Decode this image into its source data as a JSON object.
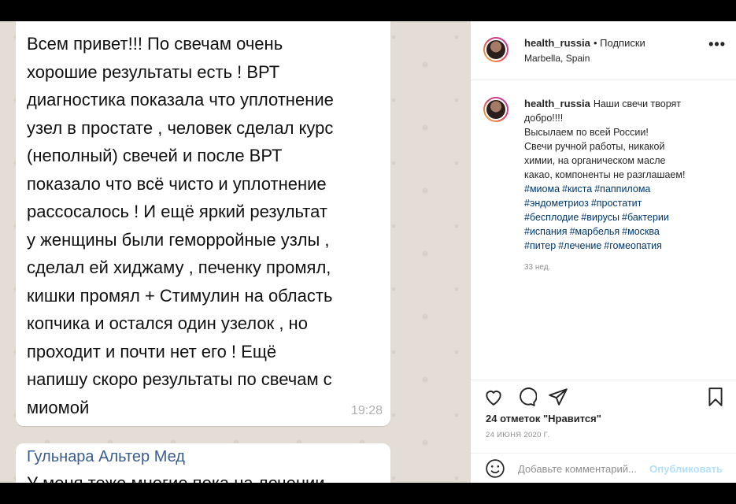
{
  "chat": {
    "message_lines": "Всем привет!!! По свечам очень\nхорошие результаты есть ! ВРТ\nдиагностика показала что уплотнение\nузел в простате , человек сделал курс\n(неполный) свечей и после ВРТ\nпоказало что всё чисто и уплотнение\nрассосалось ! И ещё яркий результат\nу женщины были геморройные узлы ,\nсделал ей хиджаму , печенку промял,\nкишки промял + Стимулин на область\nкопчика и остался один узелок , но\nпроходит и почти нет его ! Ещё\nнапишу скоро результаты по свечам с\nмиомой",
    "time": "19:28",
    "next_sender": "Гульнара Альтер Мед",
    "next_text_partial": "У меня тоже многие пока на лечении"
  },
  "post": {
    "username": "health_russia",
    "follow_label": "• Подписки",
    "location": "Marbella, Spain",
    "more_label": "•••",
    "caption_lines": [
      "Наши свечи творят",
      "добро!!!!",
      "Высылаем по всей России!",
      "Свечи ручной работы, никакой",
      "химии, на органическом масле",
      "какао, компоненты не разглашаем!"
    ],
    "hashtag_lines": [
      [
        "#миома",
        "#киста",
        "#паппилома"
      ],
      [
        "#эндометриоз",
        "#простатит"
      ],
      [
        "#бесплодие",
        "#вирусы",
        "#бактерии"
      ],
      [
        "#испания",
        "#марбелья",
        "#москва"
      ],
      [
        "#питер",
        "#лечение",
        "#гомеопатия"
      ]
    ],
    "weeks_ago": "33 нед.",
    "likes": "24 отметок \"Нравится\"",
    "date": "24 ИЮНЯ 2020 Г.",
    "comment_placeholder": "Добавьте комментарий...",
    "post_button": "Опубликовать"
  },
  "icons": [
    "heart-icon",
    "comment-icon",
    "share-icon",
    "bookmark-icon",
    "emoji-icon"
  ]
}
